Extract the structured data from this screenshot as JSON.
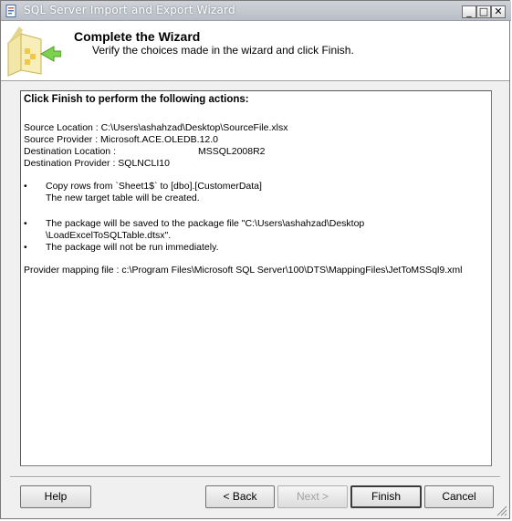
{
  "window": {
    "title": "SQL Server Import and Export Wizard"
  },
  "titlebar": {
    "minimize": "_",
    "maximize": "□",
    "close": "✕"
  },
  "header": {
    "title": "Complete the Wizard",
    "subtitle": "Verify the choices made in the wizard and click Finish."
  },
  "content": {
    "heading": "Click Finish to perform the following actions:",
    "source_location": "Source Location : C:\\Users\\ashahzad\\Desktop\\SourceFile.xlsx",
    "source_provider": "Source Provider : Microsoft.ACE.OLEDB.12.0",
    "destination_location_label": "Destination Location :",
    "destination_location_value": "MSSQL2008R2",
    "destination_provider": "Destination Provider : SQLNCLI10",
    "bullet": "•",
    "copy_rows": "Copy rows from `Sheet1$` to [dbo].[CustomerData]",
    "new_table": "The new target table will be created.",
    "package_saved_line1": "The package will be saved to the package file \"C:\\Users\\ashahzad\\Desktop",
    "package_saved_line2": "\\LoadExcelToSQLTable.dtsx\".",
    "not_run": "The package will not be run immediately.",
    "mapping_file": "Provider mapping file : c:\\Program Files\\Microsoft SQL Server\\100\\DTS\\MappingFiles\\JetToMSSql9.xml"
  },
  "buttons": {
    "help": "Help",
    "back": "< Back",
    "next": "Next >",
    "finish": "Finish",
    "cancel": "Cancel"
  },
  "icons": {
    "app": "wizard-app-icon",
    "header": "wizard-folder-arrow-icon",
    "resize": "resize-grip-icon"
  }
}
